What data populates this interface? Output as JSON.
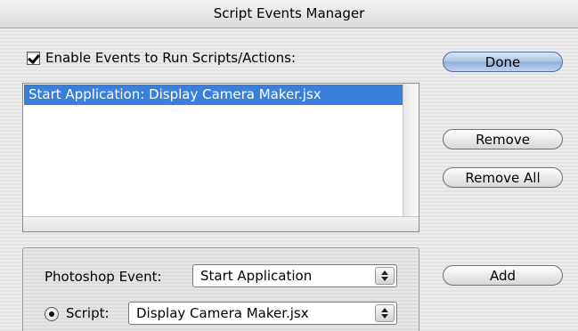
{
  "window": {
    "title": "Script Events Manager"
  },
  "enable_events": {
    "label": "Enable Events to Run Scripts/Actions:",
    "checked": true
  },
  "events_list": {
    "items": [
      "Start Application: Display Camera Maker.jsx"
    ],
    "selected_index": 0
  },
  "buttons": {
    "done": "Done",
    "remove": "Remove",
    "remove_all": "Remove All",
    "add": "Add"
  },
  "event_panel": {
    "event_label": "Photoshop Event:",
    "event_value": "Start Application",
    "script_label": "Script:",
    "script_value": "Display Camera Maker.jsx",
    "script_selected": true
  }
}
